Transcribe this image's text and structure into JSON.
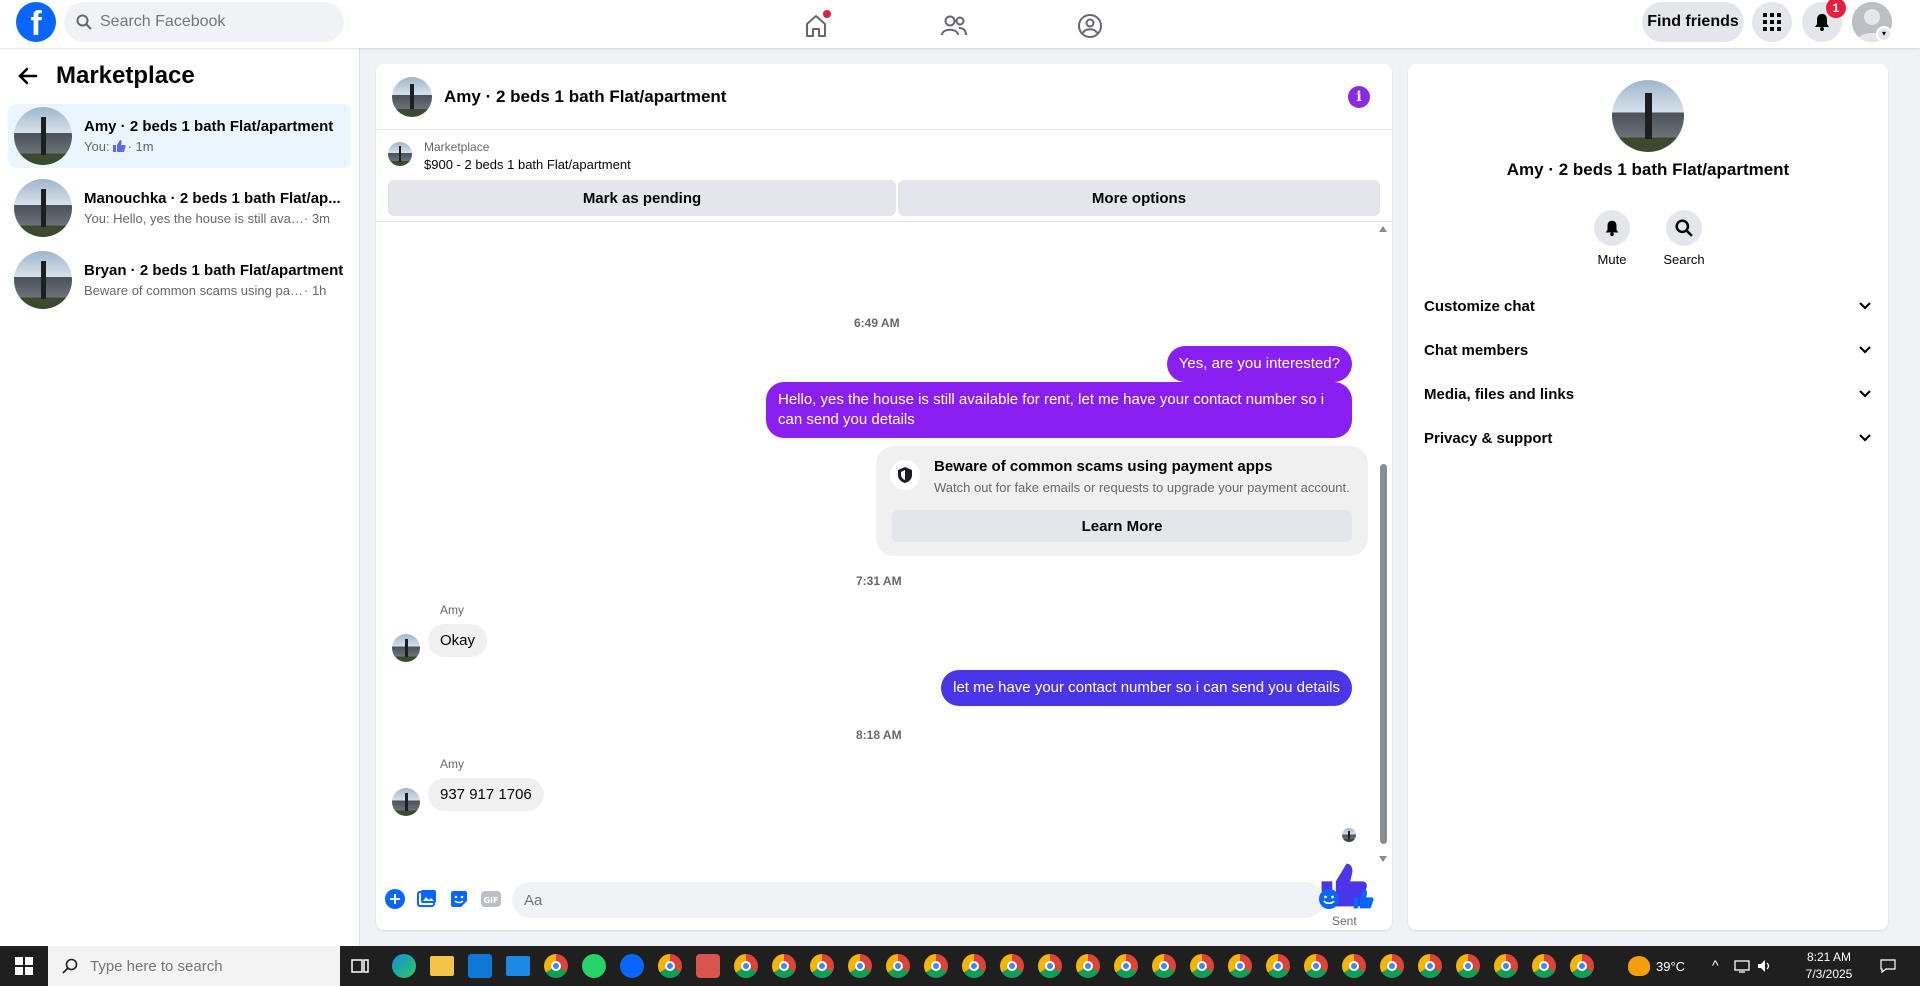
{
  "topbar": {
    "search_placeholder": "Search Facebook",
    "find_friends_label": "Find friends",
    "notification_count": "1",
    "logo_letter": "f"
  },
  "sidebar": {
    "title": "Marketplace",
    "conversations": [
      {
        "title": "Amy · 2 beds 1 bath Flat/apartment",
        "prefix": "You: ",
        "snippet": "",
        "time": " · 1m",
        "active": true
      },
      {
        "title": "Manouchka · 2 beds 1 bath Flat/ap...",
        "prefix": "",
        "snippet": "You: Hello, yes the house is still availa...",
        "time": " · 3m",
        "active": false
      },
      {
        "title": "Bryan · 2 beds 1 bath Flat/apartment",
        "prefix": "",
        "snippet": "Beware of common scams using pay...",
        "time": " · 1h",
        "active": false
      }
    ]
  },
  "chat": {
    "header_title": "Amy · 2 beds 1 bath Flat/apartment",
    "info_glyph": "i",
    "listing_label": "Marketplace",
    "listing_price": "$900 - 2 beds 1 bath Flat/apartment",
    "mark_pending_label": "Mark as pending",
    "more_options_label": "More options",
    "messages": {
      "ts1": "6:49 AM",
      "out1": "Yes, are you interested?",
      "out2": "Hello, yes the house is still available for rent, let me have your contact number so i can send you details",
      "scam_title": "Beware of common scams using payment apps",
      "scam_desc": "Watch out for fake emails or requests to upgrade your payment account.",
      "learn_more": "Learn More",
      "ts2": "7:31 AM",
      "sender1": "Amy",
      "in1": "Okay",
      "out3": "let me have your contact number so i can send you details",
      "ts3": "8:18 AM",
      "sender2": "Amy",
      "in2": "937 917 1706",
      "sent_status": "Sent"
    },
    "composer_placeholder": "Aa"
  },
  "right_panel": {
    "title": "Amy · 2 beds 1 bath Flat/apartment",
    "mute_label": "Mute",
    "search_label": "Search",
    "sections": [
      "Customize chat",
      "Chat members",
      "Media, files and links",
      "Privacy & support"
    ]
  },
  "taskbar": {
    "search_placeholder": "Type here to search",
    "temperature": "39°C",
    "time": "8:21 AM",
    "date": "7/3/2025"
  },
  "colors": {
    "brand": "#0866ff",
    "outgoing_purple": "#8a1ff2",
    "outgoing_blue": "#4a35e8",
    "like_blue": "#4a35e8",
    "badge_red": "#e41e3f"
  }
}
